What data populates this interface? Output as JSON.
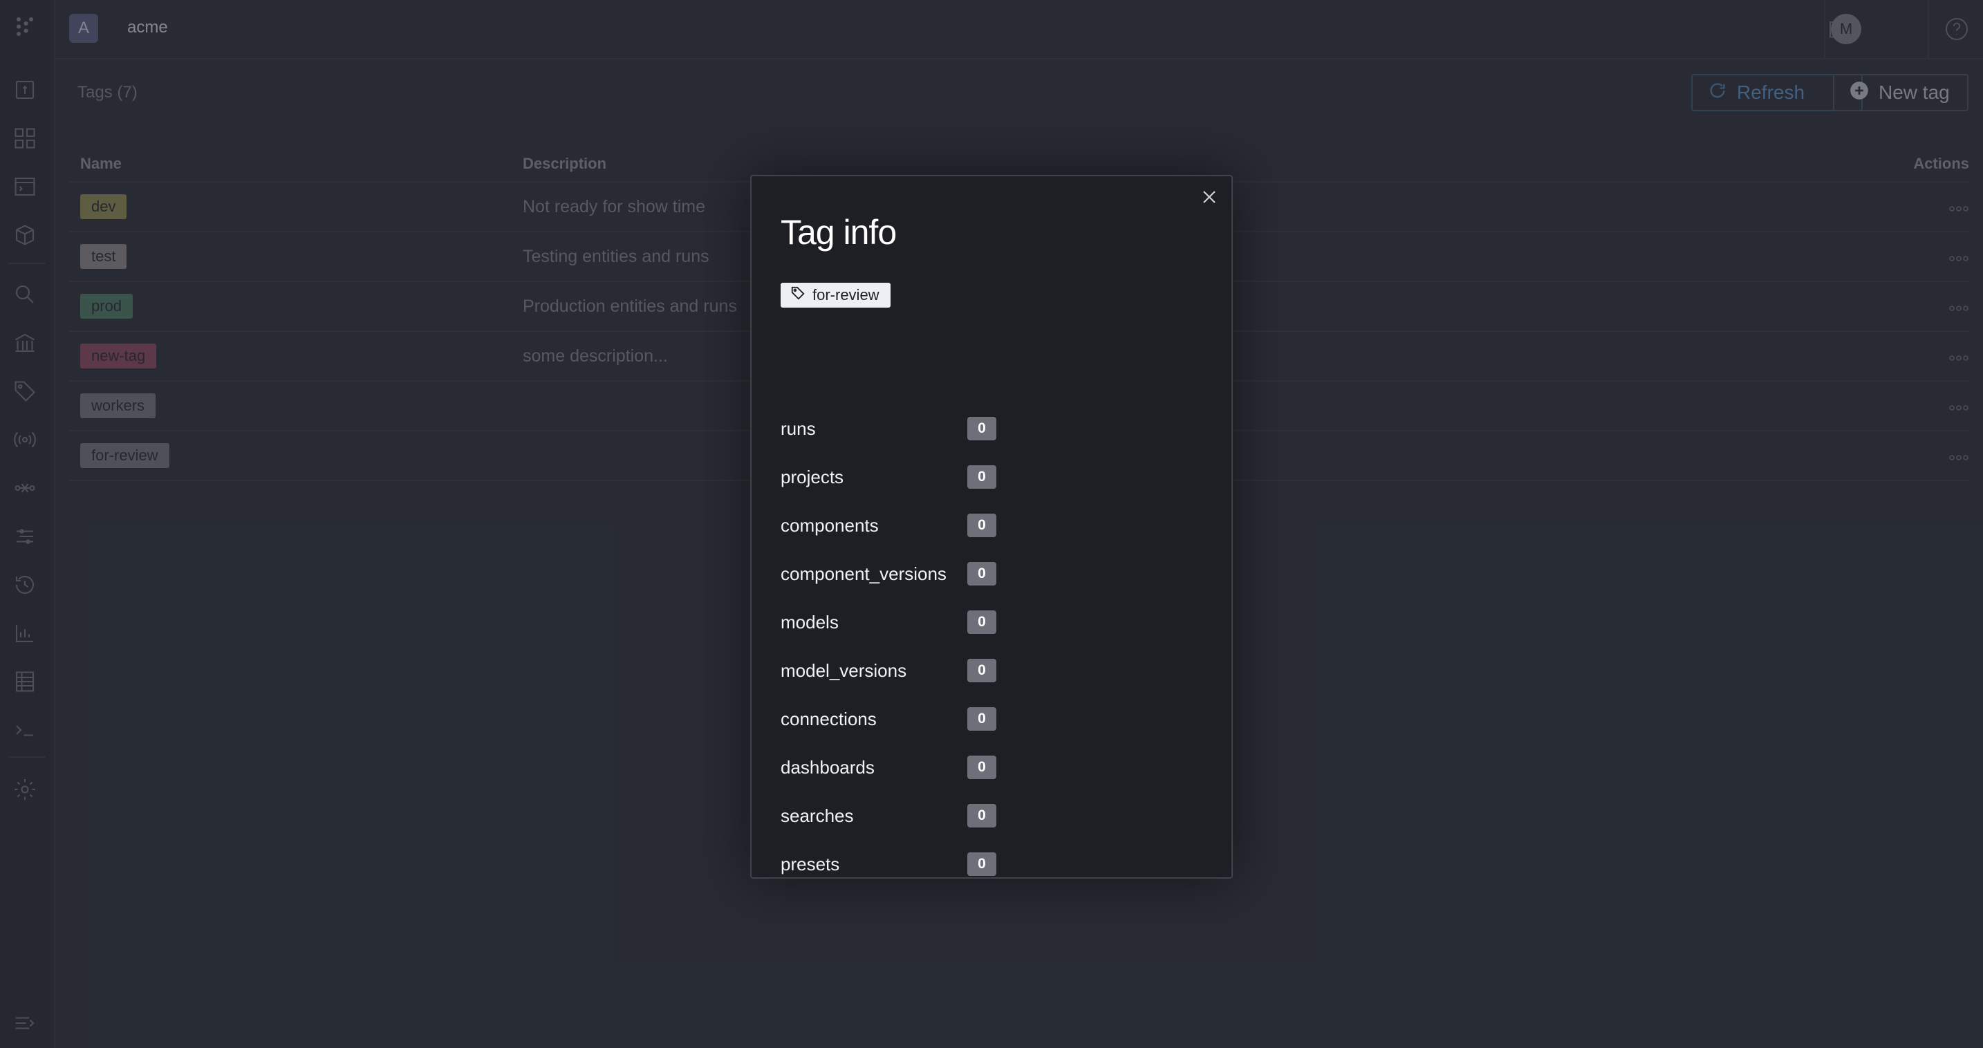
{
  "header": {
    "org_initial": "A",
    "org_name": "acme",
    "user_initial": "M"
  },
  "page": {
    "title": "Tags (7)",
    "refresh_label": "Refresh",
    "new_tag_label": "New tag"
  },
  "table": {
    "columns": [
      "Name",
      "Description",
      "Actions"
    ],
    "rows": [
      {
        "name": "dev",
        "color": "#8c8a55",
        "description": "Not ready for show time"
      },
      {
        "name": "test",
        "color": "#8a8788",
        "description": "Testing entities and runs"
      },
      {
        "name": "prod",
        "color": "#4f7a66",
        "description": "Production entities and runs"
      },
      {
        "name": "new-tag",
        "color": "#8b4a63",
        "description": "some description..."
      },
      {
        "name": "workers",
        "color": "#74767c",
        "description": ""
      },
      {
        "name": "for-review",
        "color": "#74767c",
        "description": ""
      }
    ]
  },
  "modal": {
    "title": "Tag info",
    "tag": "for-review",
    "stats": [
      {
        "label": "runs",
        "count": "0"
      },
      {
        "label": "projects",
        "count": "0"
      },
      {
        "label": "components",
        "count": "0"
      },
      {
        "label": "component_versions",
        "count": "0"
      },
      {
        "label": "models",
        "count": "0"
      },
      {
        "label": "model_versions",
        "count": "0"
      },
      {
        "label": "connections",
        "count": "0"
      },
      {
        "label": "dashboards",
        "count": "0"
      },
      {
        "label": "searches",
        "count": "0"
      },
      {
        "label": "presets",
        "count": "0"
      }
    ]
  },
  "icons": {
    "rail": [
      "logo-icon",
      "file-icon",
      "grid-icon",
      "terminal-window-icon",
      "cube-icon",
      "search-icon",
      "bank-icon",
      "tag-icon",
      "broadcast-icon",
      "pipeline-icon",
      "filter-icon",
      "history-icon",
      "chart-icon",
      "table-icon",
      "console-icon",
      "settings-icon",
      "collapse-icon"
    ],
    "top": [
      "folder-icon",
      "help-icon"
    ]
  }
}
